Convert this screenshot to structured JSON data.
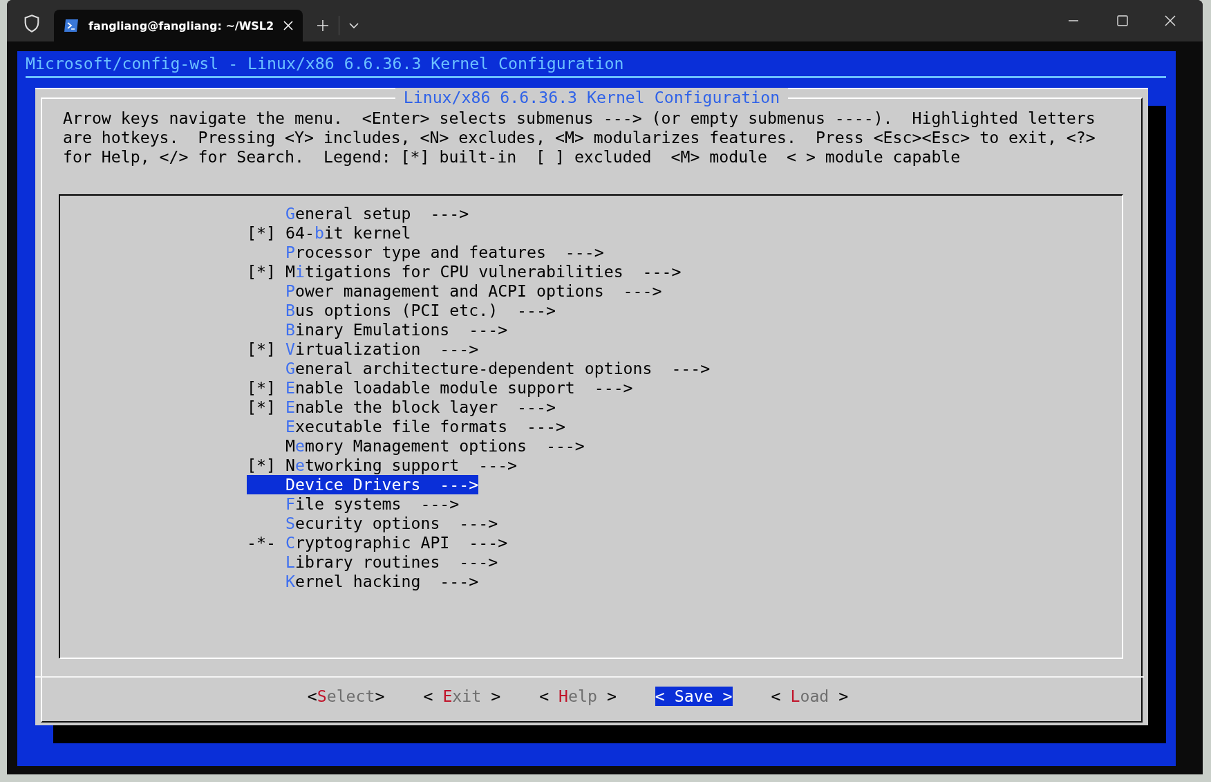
{
  "window": {
    "tab_title": "fangliang@fangliang: ~/WSL2"
  },
  "screen_title": "Microsoft/config-wsl - Linux/x86 6.6.36.3 Kernel Configuration",
  "dialog": {
    "title": "Linux/x86 6.6.36.3 Kernel Configuration",
    "help_lines": [
      "Arrow keys navigate the menu.  <Enter> selects submenus ---> (or empty submenus ----).  Highlighted letters",
      "are hotkeys.  Pressing <Y> includes, <N> excludes, <M> modularizes features.  Press <Esc><Esc> to exit, <?>",
      "for Help, </> for Search.  Legend: [*] built-in  [ ] excluded  <M> module  < > module capable"
    ]
  },
  "menu": [
    {
      "hotkey": "G",
      "after": "eneral setup  --->",
      "selected": false
    },
    {
      "marker": "[*]",
      "before": "64-",
      "hotkey": "b",
      "after": "it kernel",
      "selected": false
    },
    {
      "hotkey": "P",
      "after": "rocessor type and features  --->",
      "selected": false
    },
    {
      "marker": "[*]",
      "before": "M",
      "hotkey": "i",
      "after": "tigations for CPU vulnerabilities  --->",
      "selected": false
    },
    {
      "hotkey": "P",
      "after": "ower management and ACPI options  --->",
      "selected": false
    },
    {
      "hotkey": "B",
      "after": "us options (PCI etc.)  --->",
      "selected": false
    },
    {
      "hotkey": "B",
      "after": "inary Emulations  --->",
      "selected": false
    },
    {
      "marker": "[*]",
      "hotkey": "V",
      "after": "irtualization  --->",
      "selected": false
    },
    {
      "hotkey": "G",
      "after": "eneral architecture-dependent options  --->",
      "selected": false
    },
    {
      "marker": "[*]",
      "hotkey": "E",
      "after": "nable loadable module support  --->",
      "selected": false
    },
    {
      "marker": "[*]",
      "hotkey": "E",
      "after": "nable the block layer  --->",
      "selected": false
    },
    {
      "hotkey": "E",
      "after": "xecutable file formats  --->",
      "selected": false
    },
    {
      "before": "M",
      "hotkey": "e",
      "after": "mory Management options  --->",
      "selected": false
    },
    {
      "marker": "[*]",
      "before": "N",
      "hotkey": "e",
      "after": "tworking support  --->",
      "selected": false
    },
    {
      "hotkey": "D",
      "after": "evice Drivers  --->",
      "selected": true
    },
    {
      "hotkey": "F",
      "after": "ile systems  --->",
      "selected": false
    },
    {
      "hotkey": "S",
      "after": "ecurity options  --->",
      "selected": false
    },
    {
      "marker": "-*-",
      "hotkey": "C",
      "after": "ryptographic API  --->",
      "selected": false
    },
    {
      "hotkey": "L",
      "after": "ibrary routines  --->",
      "selected": false
    },
    {
      "hotkey": "K",
      "after": "ernel hacking  --->",
      "selected": false
    }
  ],
  "buttons": [
    {
      "open": "<",
      "hotkey": "S",
      "rest": "elect",
      "close": ">",
      "selected": false
    },
    {
      "open": "< ",
      "hotkey": "E",
      "rest": "xit",
      "close": " >",
      "selected": false
    },
    {
      "open": "< ",
      "hotkey": "H",
      "rest": "elp",
      "close": " >",
      "selected": false
    },
    {
      "open": "< ",
      "hotkey": "S",
      "rest": "ave",
      "close": " >",
      "selected": true
    },
    {
      "open": "< ",
      "hotkey": "L",
      "rest": "oad",
      "close": " >",
      "selected": false
    }
  ]
}
